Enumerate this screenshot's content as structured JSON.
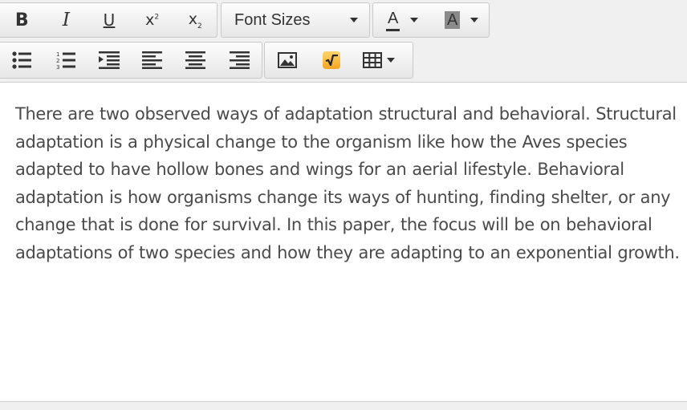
{
  "toolbar": {
    "row1": {
      "bold_label": "B",
      "italic_label": "I",
      "underline_label": "U",
      "superscript_label": "x",
      "superscript_mark": "2",
      "subscript_label": "x",
      "subscript_mark": "2",
      "font_sizes_label": "Font Sizes",
      "text_color_label": "A",
      "highlight_color_label": "A"
    },
    "row2": {
      "icons": [
        "bullet-list-icon",
        "numbered-list-icon",
        "indent-icon",
        "align-left-icon",
        "align-center-icon",
        "align-right-icon",
        "image-icon",
        "math-icon",
        "table-icon"
      ]
    },
    "colors": {
      "math_accent": "#f5a623",
      "toolbar_bg": "#f0f0f0",
      "text": "#4a4a4a"
    }
  },
  "editor": {
    "content": "There are two observed ways of adaptation structural and behavioral. Structural adaptation is a physical change to the organism like how the Aves species adapted to have hollow bones and wings for an aerial lifestyle. Behavioral adaptation is how organisms change its ways of hunting, finding shelter, or any change that is done for survival. In this paper, the focus will be on behavioral adaptations of two species and how they are adapting to an exponential growth."
  }
}
